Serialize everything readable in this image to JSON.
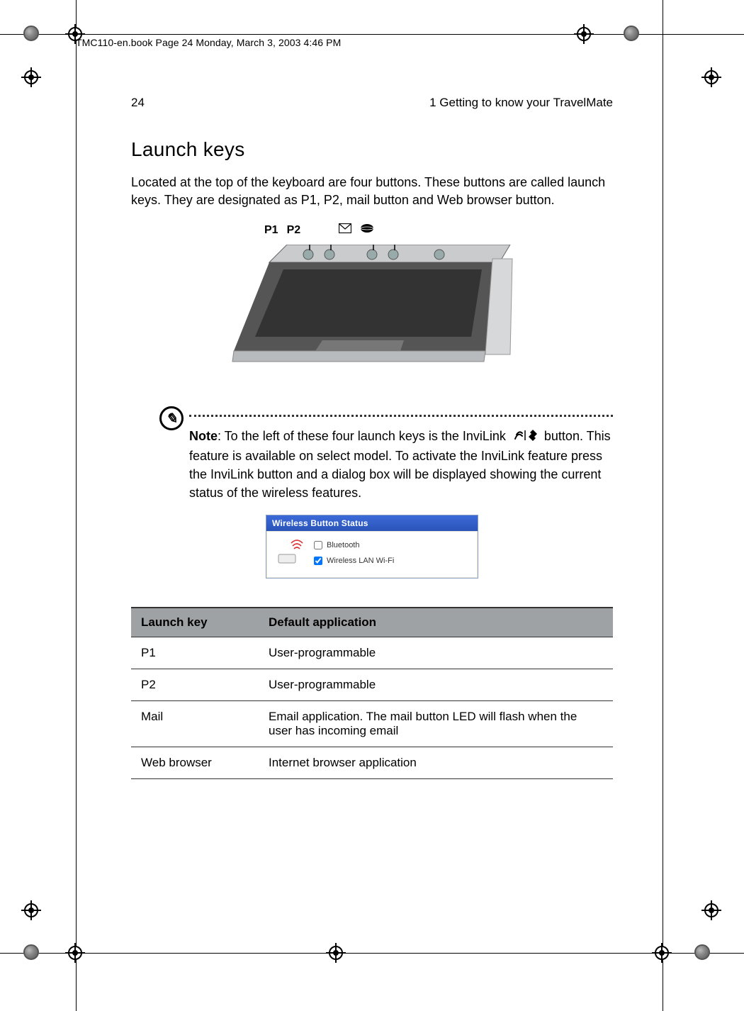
{
  "meta": {
    "source_line": "TMC110-en.book  Page 24  Monday, March 3, 2003  4:46 PM"
  },
  "header": {
    "page_number": "24",
    "chapter": "1 Getting to know your TravelMate"
  },
  "section": {
    "title": "Launch keys",
    "intro": "Located at the top of the keyboard are four buttons.  These buttons are called launch keys.  They are designated as P1, P2, mail button and Web browser button."
  },
  "laptop_labels": {
    "p1": "P1",
    "p2": "P2"
  },
  "note": {
    "prefix": "Note",
    "text_part1": ": To the left of these four launch keys is the InviLink ",
    "text_part2": " button.  This feature is available on select model.  To activate the InviLink feature press the InviLink button and a dialog box will be displayed showing the current status of the wireless features."
  },
  "dialog": {
    "title": "Wireless Button Status",
    "opt1": "Bluetooth",
    "opt2": "Wireless LAN Wi-Fi",
    "opt1_checked": false,
    "opt2_checked": true
  },
  "table": {
    "headers": {
      "c1": "Launch key",
      "c2": "Default application"
    },
    "rows": [
      {
        "key": "P1",
        "app": "User-programmable"
      },
      {
        "key": "P2",
        "app": "User-programmable"
      },
      {
        "key": "Mail",
        "app": "Email application.  The mail button LED will flash when the user has incoming email"
      },
      {
        "key": "Web browser",
        "app": "Internet browser application"
      }
    ]
  }
}
